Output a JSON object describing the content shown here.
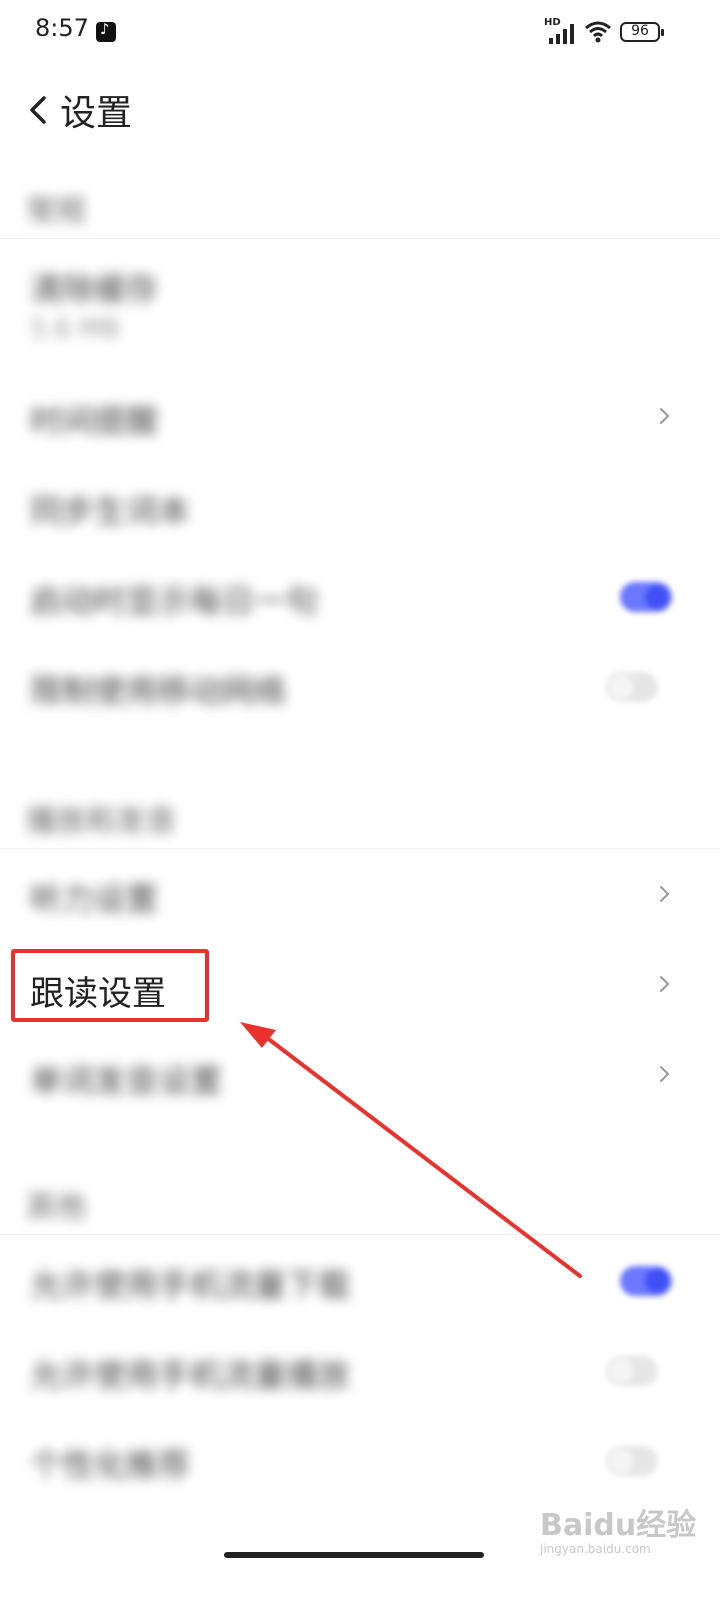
{
  "status_bar": {
    "time": "8:57",
    "network_label": "HD",
    "battery": "96",
    "icons": [
      "tiktok-icon",
      "signal-icon",
      "wifi-icon",
      "battery-icon"
    ]
  },
  "header": {
    "back_icon": "chevron-left-icon",
    "title": "设置"
  },
  "sections": [
    {
      "title": "常规",
      "rows": [
        {
          "label": "清除缓存",
          "sub": "5.6 MB",
          "control": "none"
        },
        {
          "label": "时间提醒",
          "control": "chevron"
        },
        {
          "label": "同步生词本",
          "control": "none"
        },
        {
          "label": "启动时显示每日一句",
          "control": "toggle",
          "on": true
        },
        {
          "label": "限制使用移动网络",
          "control": "toggle",
          "on": false
        }
      ]
    },
    {
      "title": "播放和发音",
      "rows": [
        {
          "label": "听力设置",
          "control": "chevron"
        },
        {
          "label": "跟读设置",
          "control": "chevron",
          "highlighted": true
        },
        {
          "label": "单词发音设置",
          "control": "chevron"
        }
      ]
    },
    {
      "title": "其他",
      "rows": [
        {
          "label": "允许使用手机流量下载",
          "control": "toggle",
          "on": true
        },
        {
          "label": "允许使用手机流量播放",
          "control": "toggle",
          "on": false
        },
        {
          "label": "个性化推荐",
          "control": "toggle",
          "on": false
        }
      ]
    }
  ],
  "watermark": {
    "logo": "Baidu经验",
    "sub": "jingyan.baidu.com"
  },
  "colors": {
    "accent": "#4050f5",
    "highlight": "#e8322d"
  }
}
